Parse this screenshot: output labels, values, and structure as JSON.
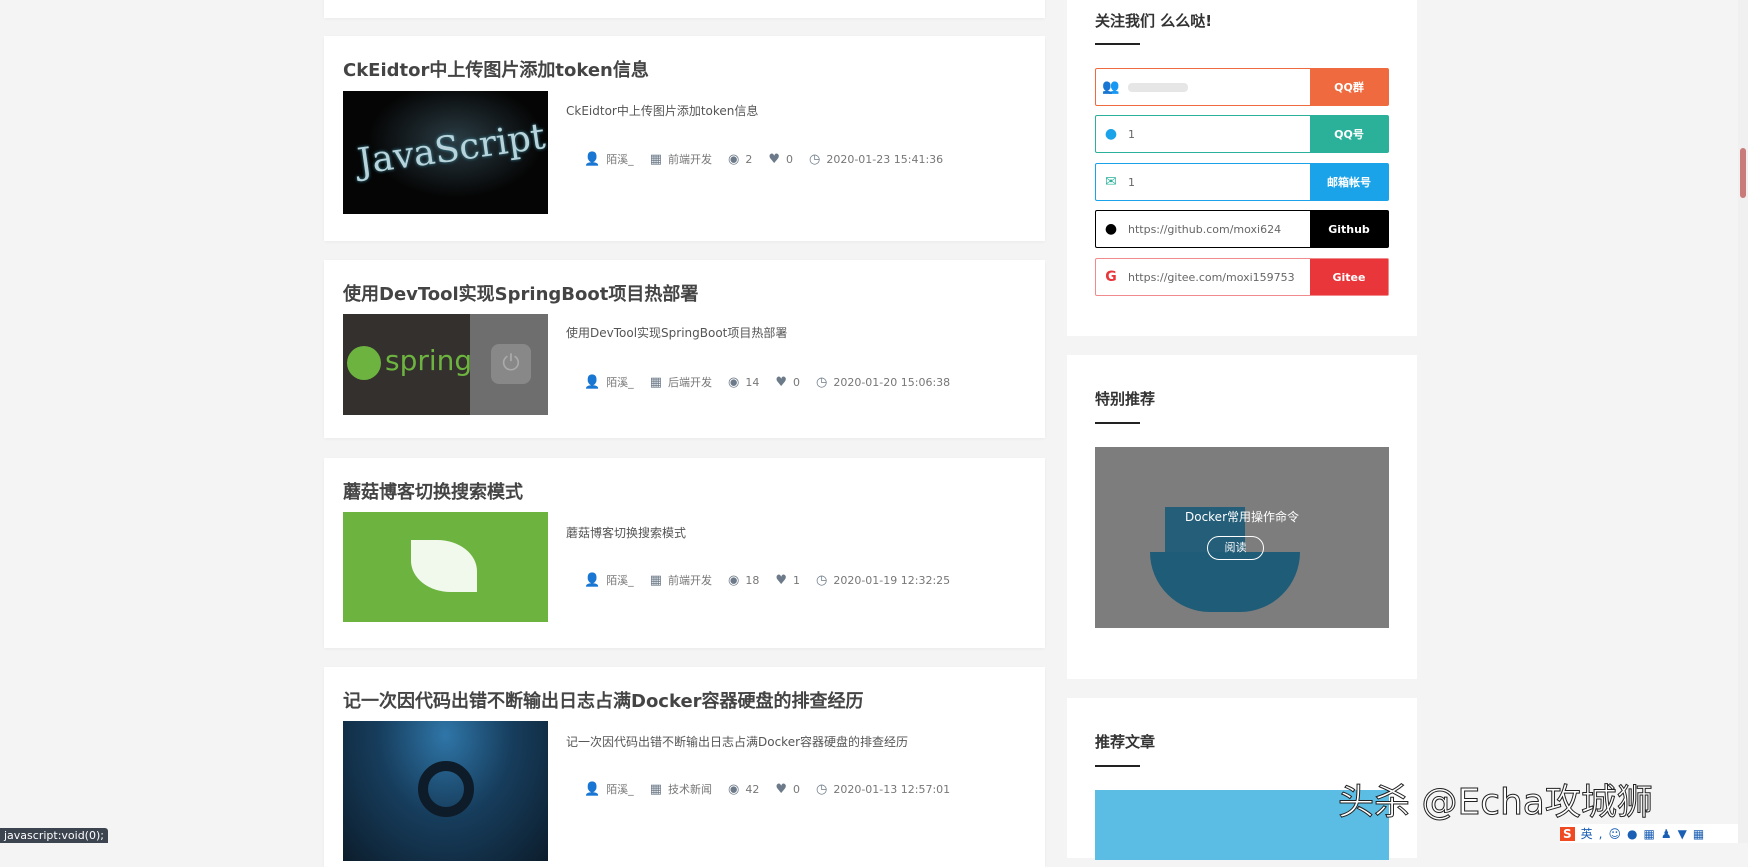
{
  "articles": [
    {
      "title": "CkEidtor中上传图片添加token信息",
      "summary": "CkEidtor中上传图片添加token信息",
      "author": "陌溪_",
      "category": "前端开发",
      "views": "2",
      "likes": "0",
      "date": "2020-01-23 15:41:36",
      "thumb_text": "JavaScript"
    },
    {
      "title": "使用DevTool实现SpringBoot项目热部署",
      "summary": "使用DevTool实现SpringBoot项目热部署",
      "author": "陌溪_",
      "category": "后端开发",
      "views": "14",
      "likes": "0",
      "date": "2020-01-20 15:06:38",
      "thumb_text": "spring"
    },
    {
      "title": "蘑菇博客切换搜索模式",
      "summary": "蘑菇博客切换搜索模式",
      "author": "陌溪_",
      "category": "前端开发",
      "views": "18",
      "likes": "1",
      "date": "2020-01-19 12:32:25"
    },
    {
      "title": "记一次因代码出错不断输出日志占满Docker容器硬盘的排查经历",
      "summary": "记一次因代码出错不断输出日志占满Docker容器硬盘的排查经历",
      "author": "陌溪_",
      "category": "技术新闻",
      "views": "42",
      "likes": "0",
      "date": "2020-01-13 12:57:01"
    }
  ],
  "follow": {
    "title": "关注我们 么么哒!",
    "rows": [
      {
        "icon": "users-icon",
        "value": "",
        "button": "QQ群",
        "color": "#f06a3f"
      },
      {
        "icon": "qq-icon",
        "value": "1",
        "button": "QQ号",
        "color": "#2bb09a"
      },
      {
        "icon": "mail-icon",
        "value": "1",
        "button": "邮箱帐号",
        "color": "#1aa3e8"
      },
      {
        "icon": "github-icon",
        "value": "https://github.com/moxi624",
        "button": "Github",
        "color": "#000000"
      },
      {
        "icon": "gitee-icon",
        "value": "https://gitee.com/moxi159753",
        "button": "Gitee",
        "color": "#e8363b"
      }
    ]
  },
  "special": {
    "title": "特别推荐",
    "caption": "Docker常用操作命令",
    "read": "阅读"
  },
  "recommend": {
    "title": "推荐文章"
  },
  "status_bar": "javascript:void(0);",
  "watermark": "头杀 @Echa攻城狮",
  "ime": {
    "lang": "英"
  }
}
